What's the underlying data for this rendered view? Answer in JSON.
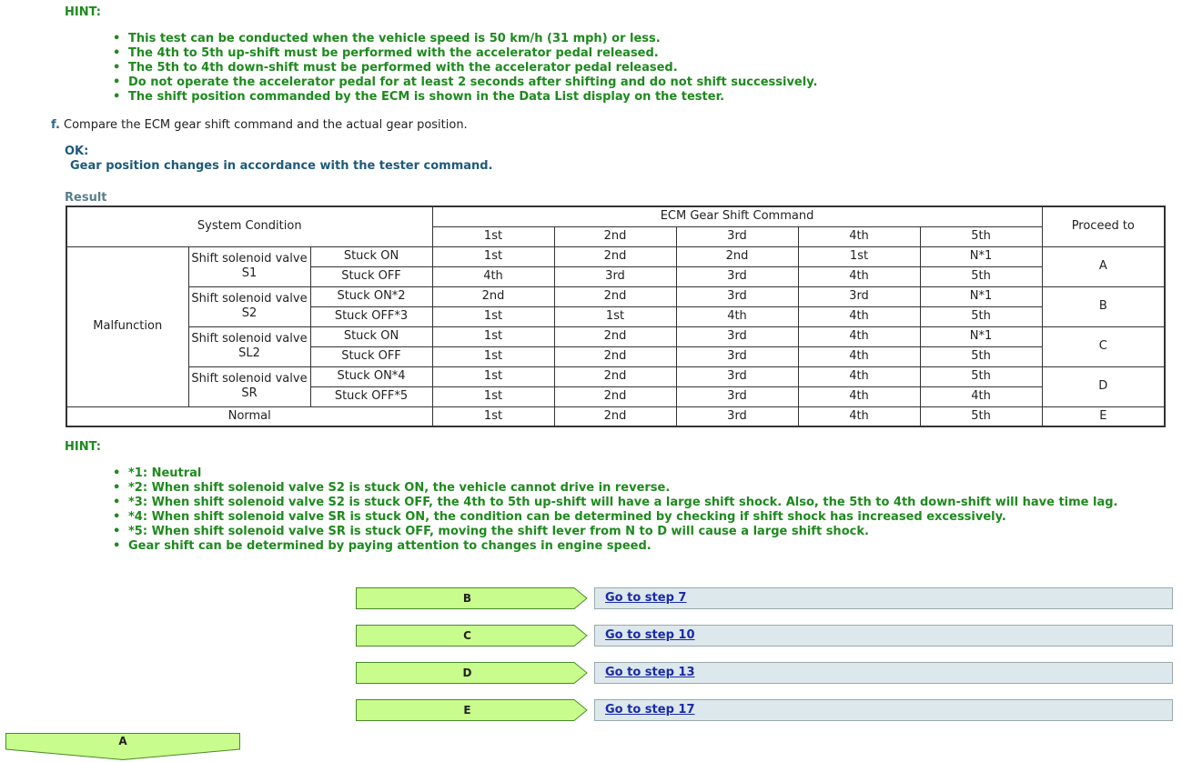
{
  "hint1": {
    "title": "HINT:",
    "items": [
      "This test can be conducted when the vehicle speed is 50 km/h (31 mph) or less.",
      "The 4th to 5th up-shift must be performed with the accelerator pedal released.",
      "The 5th to 4th down-shift must be performed with the accelerator pedal released.",
      "Do not operate the accelerator pedal for at least 2 seconds after shifting and do not shift successively.",
      "The shift position commanded by the ECM is shown in the Data List display on the tester."
    ]
  },
  "step": {
    "letter": "f.",
    "text": "Compare the ECM gear shift command and the actual gear position."
  },
  "ok": {
    "title": "OK:",
    "text": "Gear position changes in accordance with the tester command."
  },
  "result": {
    "title": "Result",
    "header": {
      "system_condition": "System Condition",
      "ecm_command": "ECM Gear Shift Command",
      "proceed": "Proceed to",
      "gears": [
        "1st",
        "2nd",
        "3rd",
        "4th",
        "5th"
      ]
    },
    "malfunction": "Malfunction",
    "normal": "Normal",
    "groups": [
      {
        "valve": "Shift solenoid valve S1",
        "proceed": "A",
        "rows": [
          {
            "state": "Stuck ON",
            "values": [
              "1st",
              "2nd",
              "2nd",
              "1st",
              "N*1"
            ]
          },
          {
            "state": "Stuck OFF",
            "values": [
              "4th",
              "3rd",
              "3rd",
              "4th",
              "5th"
            ]
          }
        ]
      },
      {
        "valve": "Shift solenoid valve S2",
        "proceed": "B",
        "rows": [
          {
            "state": "Stuck ON*2",
            "values": [
              "2nd",
              "2nd",
              "3rd",
              "3rd",
              "N*1"
            ]
          },
          {
            "state": "Stuck OFF*3",
            "values": [
              "1st",
              "1st",
              "4th",
              "4th",
              "5th"
            ]
          }
        ]
      },
      {
        "valve": "Shift solenoid valve SL2",
        "proceed": "C",
        "rows": [
          {
            "state": "Stuck ON",
            "values": [
              "1st",
              "2nd",
              "3rd",
              "4th",
              "N*1"
            ]
          },
          {
            "state": "Stuck OFF",
            "values": [
              "1st",
              "2nd",
              "3rd",
              "4th",
              "5th"
            ]
          }
        ]
      },
      {
        "valve": "Shift solenoid valve SR",
        "proceed": "D",
        "rows": [
          {
            "state": "Stuck ON*4",
            "values": [
              "1st",
              "2nd",
              "3rd",
              "4th",
              "5th"
            ]
          },
          {
            "state": "Stuck OFF*5",
            "values": [
              "1st",
              "2nd",
              "3rd",
              "4th",
              "4th"
            ]
          }
        ]
      }
    ],
    "normal_row": {
      "values": [
        "1st",
        "2nd",
        "3rd",
        "4th",
        "5th"
      ],
      "proceed": "E"
    }
  },
  "hint2": {
    "title": "HINT:",
    "items": [
      "*1: Neutral",
      "*2: When shift solenoid valve S2 is stuck ON, the vehicle cannot drive in reverse.",
      "*3: When shift solenoid valve S2 is stuck OFF, the 4th to 5th up-shift will have a large shift shock. Also, the 5th to 4th down-shift will have time lag.",
      "*4: When shift solenoid valve SR is stuck ON, the condition can be determined by checking if shift shock has increased excessively.",
      "*5: When shift solenoid valve SR is stuck OFF, moving the shift lever from N to D will cause a large shift shock.",
      "Gear shift can be determined by paying attention to changes in engine speed."
    ]
  },
  "nav": [
    {
      "result": "B",
      "link": "Go to step 7"
    },
    {
      "result": "C",
      "link": "Go to step 10"
    },
    {
      "result": "D",
      "link": "Go to step 13"
    },
    {
      "result": "E",
      "link": "Go to step 17"
    }
  ],
  "next": {
    "result": "A"
  },
  "colors": {
    "green_text": "#1e8a1e",
    "arrow_fill": "#c8fc8c",
    "link_box": "#dde8ec",
    "link": "#1a2aa8"
  }
}
